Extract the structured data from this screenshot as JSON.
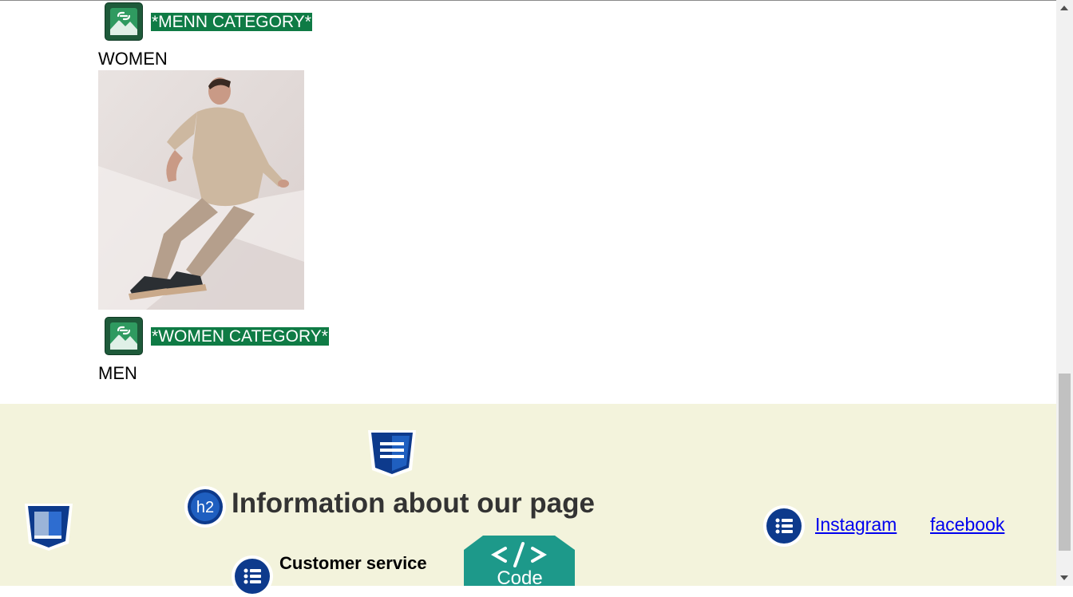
{
  "content": {
    "menn_category_label": "*MENN CATEGORY*",
    "women_heading": "WOMEN",
    "women_category_label": "*WOMEN CATEGORY*",
    "men_heading": "MEN"
  },
  "footer": {
    "title": "Information about our page",
    "customer_service": "Customer service",
    "code_label": "Code",
    "links": [
      "Instagram",
      "facebook"
    ]
  },
  "colors": {
    "category_badge_bg": "#0f7b45",
    "footer_bg": "#f3f3dc",
    "link": "#0000ee",
    "code_badge": "#1d998a",
    "icon_blue": "#0d3a8c"
  },
  "icons": [
    "image-link-icon",
    "css3-icon",
    "h2-icon",
    "list-icon",
    "code-icon",
    "window-icon"
  ]
}
